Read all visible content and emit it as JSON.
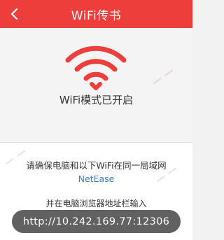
{
  "header": {
    "title": "WiFi传书"
  },
  "status": {
    "text": "WiFi模式已开启"
  },
  "instructions": {
    "line1": "请确保电脑和以下WiFi在同一局域网",
    "network_name": "NetEase",
    "line2": "并在电脑浏览器地址栏输入",
    "url": "http://10.242.169.77:12306"
  },
  "colors": {
    "brand": "#ee3e3c",
    "link": "#3a7ec6",
    "url_box": "#616161"
  },
  "icons": {
    "back": "chevron-left-icon",
    "wifi": "wifi-icon"
  }
}
